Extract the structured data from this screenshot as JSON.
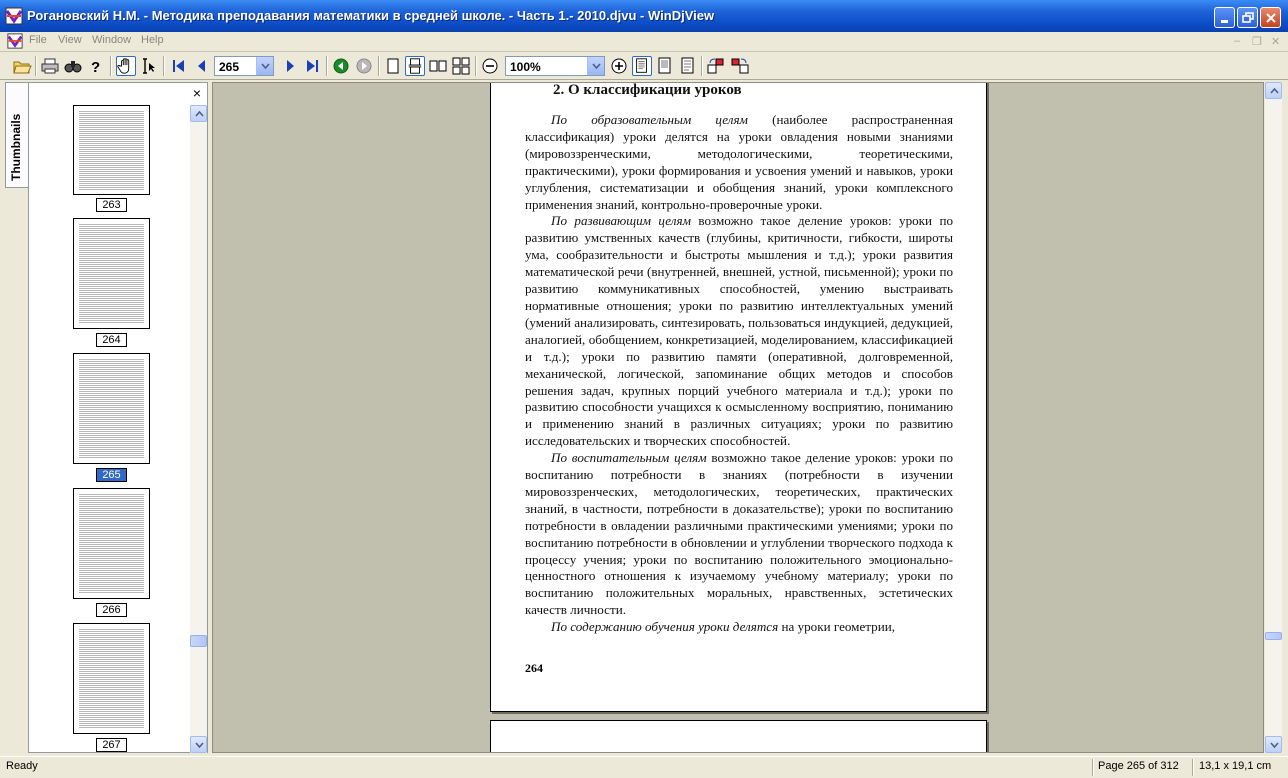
{
  "window": {
    "title": "Рогановский Н.М. - Методика преподавания математики в средней школе. - Часть 1.- 2010.djvu - WinDjView"
  },
  "menu": [
    "File",
    "View",
    "Window",
    "Help"
  ],
  "toolbar": {
    "page_number": "265",
    "zoom": "100%",
    "icons": [
      "open-icon",
      "print-icon",
      "find-icon",
      "help-icon",
      "hand-tool-icon",
      "select-tool-icon",
      "first-page-icon",
      "previous-page-icon",
      "next-page-icon",
      "last-page-icon",
      "back-icon",
      "forward-icon",
      "single-page-icon",
      "continuous-icon",
      "facing-icon",
      "continuous-facing-icon",
      "zoom-out-icon",
      "zoom-in-icon",
      "fit-page-icon",
      "fit-width-icon",
      "actual-size-icon",
      "rotate-left-icon",
      "rotate-right-icon"
    ]
  },
  "sidebar": {
    "tab_label": "Thumbnails",
    "close_label": "×",
    "thumbnails": [
      {
        "label": "263",
        "selected": false
      },
      {
        "label": "264",
        "selected": false
      },
      {
        "label": "265",
        "selected": true
      },
      {
        "label": "266",
        "selected": false
      },
      {
        "label": "267",
        "selected": false
      }
    ]
  },
  "document": {
    "heading": "2. О классификации уроков",
    "paragraphs": [
      {
        "lead": "По образовательным целям",
        "text": " (наиболее распространенная классификация) уроки делятся на уроки овладения новыми знаниями (мировоззренческими, методологическими, теоретическими, практическими), уроки формирования и усвоения умений и навыков, уроки углубления, систематизации и обобщения знаний, уроки комплексного применения знаний, контрольно-проверочные уроки."
      },
      {
        "lead": "По развивающим целям",
        "text": " возможно такое деление уроков: уроки по развитию умственных качеств (глубины, критичности, гибкости, широты ума, сообразительности и быстроты мышления и т.д.); уроки развития математической речи (внутренней, внешней, устной, письменной); уроки по развитию коммуникативных способностей, умению выстраивать нормативные отношения; уроки по развитию интеллектуальных умений (умений анализировать, синтезировать, пользоваться индукцией, дедукцией, аналогией, обобщением, конкретизацией, моделированием, классификацией и т.д.); уроки по развитию памяти (оперативной, долговременной, механической, логической, запоминание общих методов и способов решения задач, крупных порций учебного материала и т.д.); уроки по развитию способности учащихся к осмысленному восприятию, пониманию и применению знаний в различных ситуациях; уроки по развитию исследовательских и творческих способностей."
      },
      {
        "lead": "По воспитательным целям",
        "text": " возможно такое деление уроков: уроки по воспитанию потребности в знаниях (потребности в изучении мировоззренческих, методологических, теоретических, практических знаний, в частности, потребности в доказательстве); уроки по воспитанию потребности в овладении различными практическими умениями; уроки по воспитанию потребности в обновлении и углублении творческого подхода к процессу учения; уроки по воспитанию положительного эмоционально-ценностного отношения к изучаемому учебному материалу; уроки по воспитанию положительных моральных, нравственных, эстетических качеств личности."
      },
      {
        "lead": "По содержанию обучения уроки делятся",
        "text": " на уроки геометрии,"
      }
    ],
    "page_footer": "264"
  },
  "status": {
    "left": "Ready",
    "page": "Page 265 of 312",
    "size": "13,1 x 19,1 cm"
  }
}
